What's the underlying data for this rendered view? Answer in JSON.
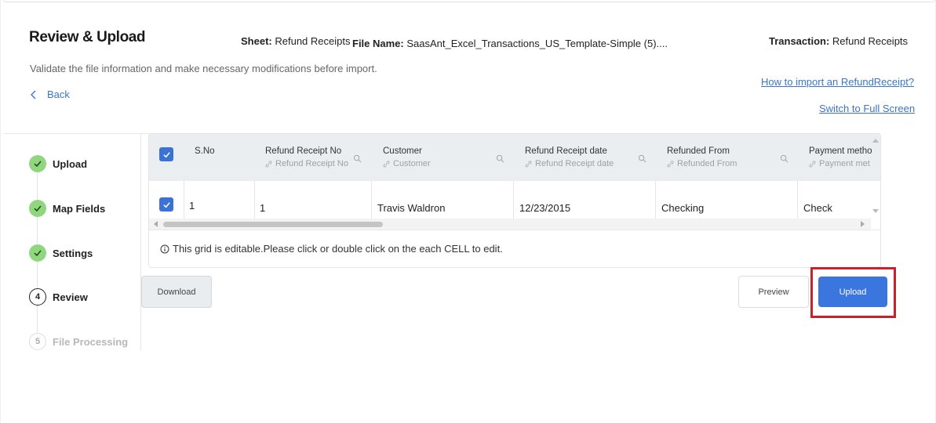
{
  "header": {
    "title": "Review & Upload",
    "subtitle": "Validate the file information and make necessary modifications before import.",
    "back_label": "Back",
    "sheet_label": "Sheet:",
    "sheet_value": "Refund Receipts",
    "file_label": "File Name:",
    "file_value": "SaasAnt_Excel_Transactions_US_Template-Simple (5)....",
    "transaction_label": "Transaction:",
    "transaction_value": "Refund Receipts",
    "howto_link": "How to import an RefundReceipt?",
    "fullscreen_link": "Switch to Full Screen"
  },
  "steps": [
    {
      "label": "Upload",
      "marker": "",
      "state": "done"
    },
    {
      "label": "Map Fields",
      "marker": "",
      "state": "done"
    },
    {
      "label": "Settings",
      "marker": "",
      "state": "done"
    },
    {
      "label": "Review",
      "marker": "4",
      "state": "current"
    },
    {
      "label": "File Processing",
      "marker": "5",
      "state": "pending"
    }
  ],
  "grid": {
    "columns": [
      {
        "label": "S.No",
        "sub": ""
      },
      {
        "label": "Refund Receipt No",
        "sub": "Refund Receipt No"
      },
      {
        "label": "Customer",
        "sub": "Customer"
      },
      {
        "label": "Refund Receipt date",
        "sub": "Refund Receipt date"
      },
      {
        "label": "Refunded From",
        "sub": "Refunded From"
      },
      {
        "label": "Payment metho",
        "sub": "Payment met"
      }
    ],
    "rows": [
      {
        "sno": "1",
        "refund_receipt_no": "1",
        "customer": "Travis Waldron",
        "date": "12/23/2015",
        "refunded_from": "Checking",
        "payment_method": "Check"
      }
    ],
    "note": "This grid is editable.Please click or double click on the each CELL to edit."
  },
  "buttons": {
    "download": "Download",
    "preview": "Preview",
    "upload": "Upload"
  },
  "colors": {
    "accent": "#3a76de",
    "link": "#3a76c4",
    "done_step": "#8fd67f",
    "highlight": "#c8232c"
  }
}
